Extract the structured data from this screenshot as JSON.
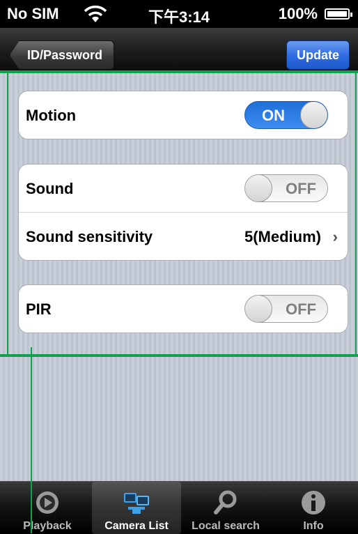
{
  "status_bar": {
    "carrier": "No SIM",
    "time": "下午3:14",
    "battery": "100%"
  },
  "nav": {
    "back_label": "ID/Password",
    "update_label": "Update"
  },
  "groups": {
    "motion": {
      "label": "Motion",
      "toggle": "ON"
    },
    "sound": {
      "label": "Sound",
      "toggle": "OFF",
      "sensitivity_label": "Sound sensitivity",
      "sensitivity_value": "5(Medium)"
    },
    "pir": {
      "label": "PIR",
      "toggle": "OFF"
    }
  },
  "tabs": [
    {
      "label": "Playback",
      "icon": "playback-icon"
    },
    {
      "label": "Camera List",
      "icon": "camera-list-icon"
    },
    {
      "label": "Local search",
      "icon": "search-icon"
    },
    {
      "label": "Info",
      "icon": "info-icon"
    }
  ],
  "colors": {
    "toggle_on": "#2b7be6",
    "update_button": "#2d6ae0",
    "overlay_green": "#0fa24e"
  }
}
